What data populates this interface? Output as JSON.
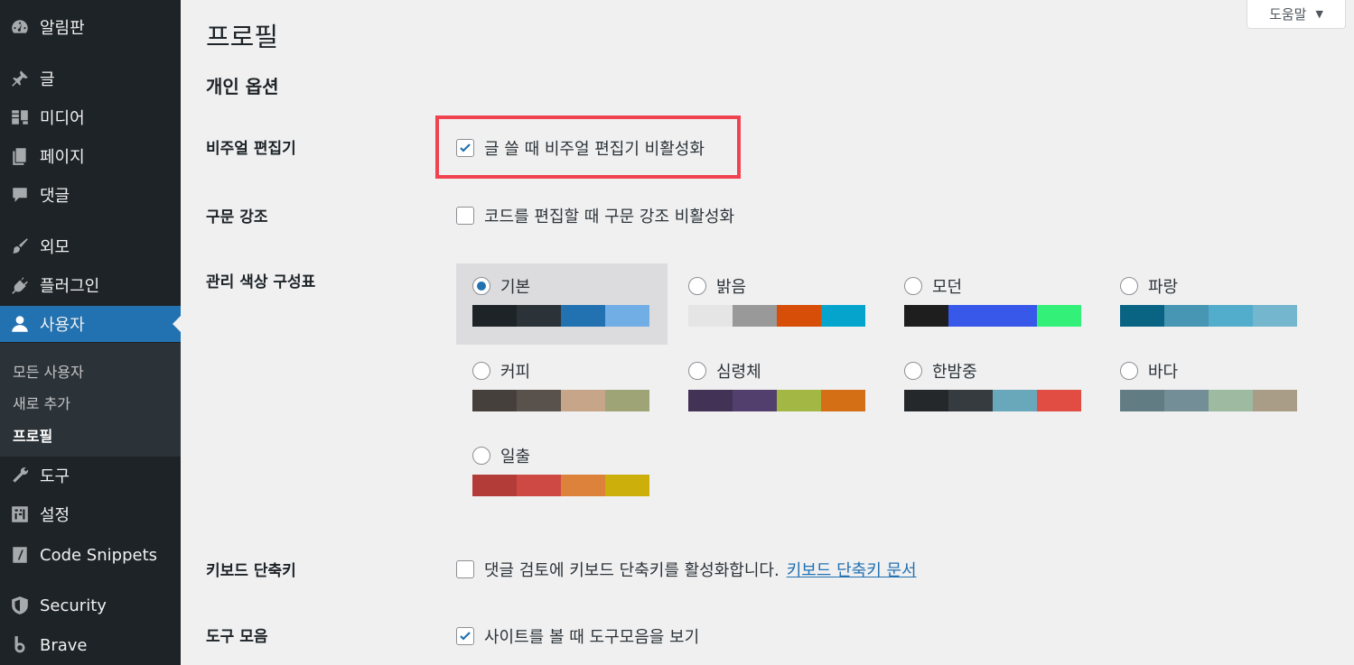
{
  "sidebar": {
    "items": [
      {
        "label": "알림판",
        "icon": "dashboard-icon"
      },
      {
        "label": "글",
        "icon": "pin-icon"
      },
      {
        "label": "미디어",
        "icon": "media-icon"
      },
      {
        "label": "페이지",
        "icon": "page-icon"
      },
      {
        "label": "댓글",
        "icon": "comment-icon"
      },
      {
        "label": "외모",
        "icon": "brush-icon"
      },
      {
        "label": "플러그인",
        "icon": "plugin-icon"
      },
      {
        "label": "사용자",
        "icon": "user-icon"
      },
      {
        "label": "도구",
        "icon": "wrench-icon"
      },
      {
        "label": "설정",
        "icon": "settings-icon"
      },
      {
        "label": "Code Snippets",
        "icon": "code-icon"
      },
      {
        "label": "Security",
        "icon": "shield-icon"
      },
      {
        "label": "Brave",
        "icon": "brave-icon"
      }
    ],
    "submenu": [
      "모든 사용자",
      "새로 추가",
      "프로필"
    ]
  },
  "help": {
    "label": "도움말",
    "arrow": "▼"
  },
  "page": {
    "title": "프로필",
    "section": "개인 옵션"
  },
  "rows": {
    "visual_editor": {
      "label": "비주얼 편집기",
      "option": "글 쓸 때 비주얼 편집기 비활성화",
      "checked": true
    },
    "syntax": {
      "label": "구문 강조",
      "option": "코드를 편집할 때 구문 강조 비활성화",
      "checked": false
    },
    "color_scheme": {
      "label": "관리 색상 구성표"
    },
    "keyboard": {
      "label": "키보드 단축키",
      "option": "댓글 검토에 키보드 단축키를 활성화합니다.",
      "link": "키보드 단축키 문서",
      "checked": false
    },
    "toolbar": {
      "label": "도구 모음",
      "option": "사이트를 볼 때 도구모음을 보기",
      "checked": true
    }
  },
  "schemes": [
    {
      "name": "기본",
      "selected": true,
      "colors": [
        "#1d2327",
        "#2c3338",
        "#2271b1",
        "#72aee6"
      ]
    },
    {
      "name": "밝음",
      "selected": false,
      "colors": [
        "#e5e5e5",
        "#999999",
        "#d64e07",
        "#04a4cc"
      ]
    },
    {
      "name": "모던",
      "selected": false,
      "colors": [
        "#1e1e1e",
        "#3858e9",
        "#3858e9",
        "#33f078"
      ]
    },
    {
      "name": "파랑",
      "selected": false,
      "colors": [
        "#096484",
        "#4796b3",
        "#52accc",
        "#74b6ce"
      ]
    },
    {
      "name": "커피",
      "selected": false,
      "colors": [
        "#46403c",
        "#59524c",
        "#c7a589",
        "#9ea476"
      ]
    },
    {
      "name": "심령체",
      "selected": false,
      "colors": [
        "#413256",
        "#523f6d",
        "#a3b745",
        "#d46f15"
      ]
    },
    {
      "name": "한밤중",
      "selected": false,
      "colors": [
        "#25282b",
        "#363b3f",
        "#69a8bb",
        "#e14d43"
      ]
    },
    {
      "name": "바다",
      "selected": false,
      "colors": [
        "#627c83",
        "#738e96",
        "#9ebaa0",
        "#aa9d88"
      ]
    },
    {
      "name": "일출",
      "selected": false,
      "colors": [
        "#b43c38",
        "#cf4944",
        "#dd823b",
        "#ccaf0b"
      ]
    }
  ]
}
